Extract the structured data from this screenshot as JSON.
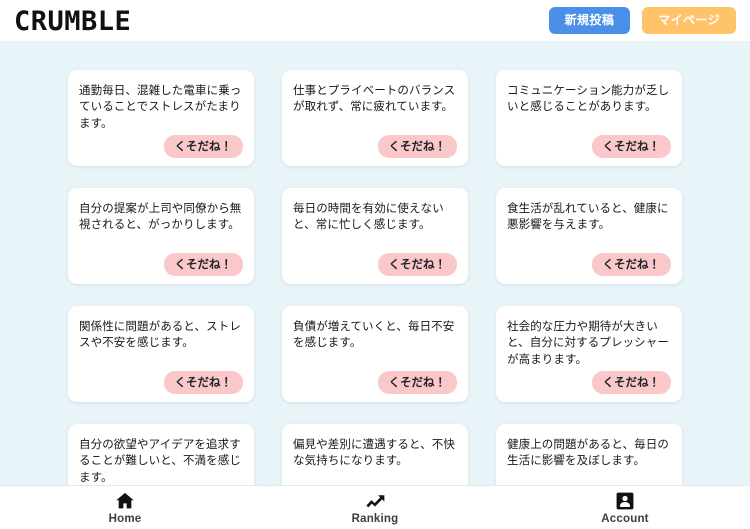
{
  "header": {
    "logo": "CRUMBLE",
    "new_post_label": "新規投稿",
    "mypage_label": "マイページ",
    "accent_blue": "#4a90e8",
    "accent_orange": "#ffc36a"
  },
  "feed": {
    "like_label": "くそだね！",
    "like_color": "#fac8c8",
    "posts": [
      {
        "text": "通勤毎日、混雑した電車に乗っていることでストレスがたまります。"
      },
      {
        "text": "仕事とプライベートのバランスが取れず、常に疲れています。"
      },
      {
        "text": "コミュニケーション能力が乏しいと感じることがあります。"
      },
      {
        "text": "自分の提案が上司や同僚から無視されると、がっかりします。"
      },
      {
        "text": "毎日の時間を有効に使えないと、常に忙しく感じます。"
      },
      {
        "text": "食生活が乱れていると、健康に悪影響を与えます。"
      },
      {
        "text": "関係性に問題があると、ストレスや不安を感じます。"
      },
      {
        "text": "負債が増えていくと、毎日不安を感じます。"
      },
      {
        "text": "社会的な圧力や期待が大きいと、自分に対するプレッシャーが高まります。"
      },
      {
        "text": "自分の欲望やアイデアを追求することが難しいと、不満を感じます。"
      },
      {
        "text": "偏見や差別に遭遇すると、不快な気持ちになります。"
      },
      {
        "text": "健康上の問題があると、毎日の生活に影響を及ぼします。"
      }
    ]
  },
  "bottom_nav": {
    "items": [
      {
        "label": "Home",
        "icon": "home-icon"
      },
      {
        "label": "Ranking",
        "icon": "trending-up-icon"
      },
      {
        "label": "Account",
        "icon": "account-badge-icon"
      }
    ]
  },
  "theme": {
    "page_background": "#e9f4f8",
    "card_background": "#ffffff",
    "text_color": "#16181b"
  }
}
